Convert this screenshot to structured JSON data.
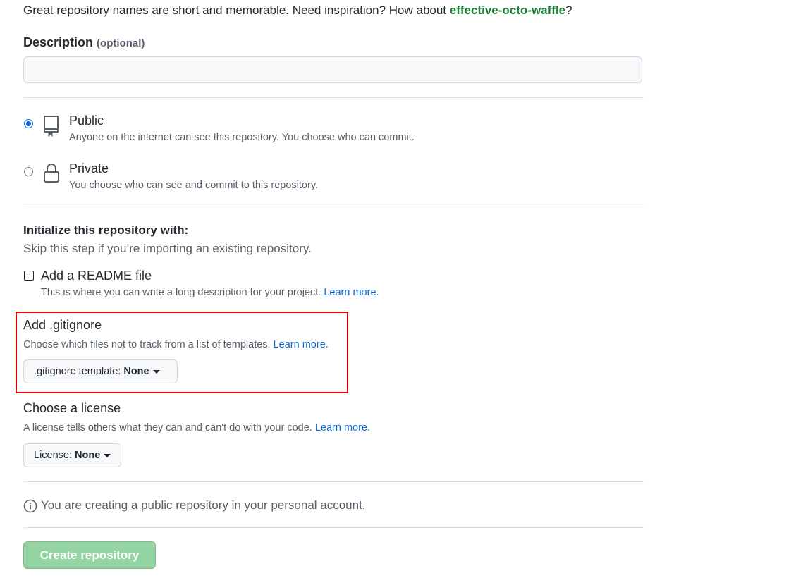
{
  "name_hint": {
    "text": "Great repository names are short and memorable. Need inspiration? How about ",
    "suggestion": "effective-octo-waffle",
    "suffix": "?"
  },
  "description": {
    "label": "Description",
    "optional": "(optional)",
    "value": ""
  },
  "visibility": {
    "selected": "Public",
    "options": [
      {
        "title": "Public",
        "subtitle": "Anyone on the internet can see this repository. You choose who can commit.",
        "icon": "repo-icon"
      },
      {
        "title": "Private",
        "subtitle": "You choose who can see and commit to this repository.",
        "icon": "lock-icon"
      }
    ]
  },
  "initialize": {
    "title": "Initialize this repository with:",
    "subtitle": "Skip this step if you’re importing an existing repository.",
    "readme": {
      "label": "Add a README file",
      "checked": false,
      "help": "This is where you can write a long description for your project.",
      "link": "Learn more."
    }
  },
  "gitignore": {
    "title": "Add .gitignore",
    "help": "Choose which files not to track from a list of templates.",
    "link": "Learn more.",
    "button_prefix": ".gitignore template:",
    "button_value": "None"
  },
  "license": {
    "title": "Choose a license",
    "help": "A license tells others what they can and can't do with your code.",
    "link": "Learn more.",
    "button_prefix": "License:",
    "button_value": "None"
  },
  "info": {
    "icon": "info-icon",
    "text": "You are creating a public repository in your personal account."
  },
  "create_button": "Create repository",
  "colors": {
    "highlight": "#e00000",
    "accent": "#0969da",
    "suggestion": "#1a7f37",
    "create_button_bg": "#94d3a2"
  }
}
